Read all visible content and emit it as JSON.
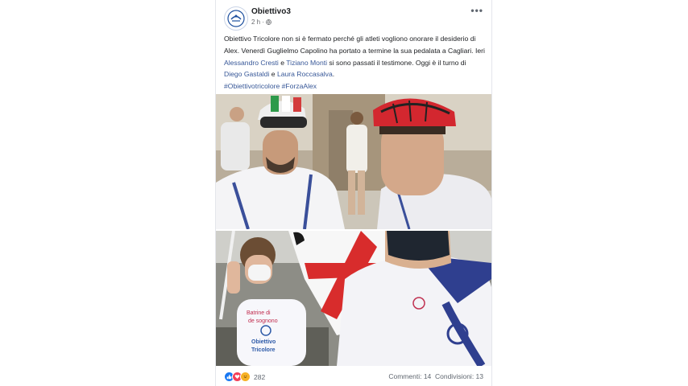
{
  "post": {
    "page_name": "Obiettivo3",
    "time": "2 h ·",
    "more": "•••",
    "text_segments": [
      "Obiettivo Tricolore non si è fermato perché gli atleti vogliono onorare il desiderio di Alex. Venerdì Guglielmo Capolino ha portato a termine la sua pedalata a Cagliari. Ieri ",
      "Alessandro Cresti",
      " e ",
      "Tiziano Monti",
      " si sono passati il testimone. Oggi è il turno di ",
      "Diego Gastaldi",
      " e ",
      "Laura Roccasalva",
      "."
    ],
    "hashtags": "#Obiettivotricolore #ForzaAlex"
  },
  "footer": {
    "reaction_count": "282",
    "stats": "Commenti: 14  Condivisioni: 13"
  },
  "shirt_text": {
    "line1": "Batrine di",
    "line2": "de sognono",
    "line3": "Obiettivo",
    "line4": "Tricolore"
  },
  "colors": {
    "link": "#385898",
    "like": "#1877f2",
    "love": "#f33e58",
    "haha": "#f7b125"
  },
  "icons": [
    "globe-icon",
    "like-reaction-icon",
    "love-reaction-icon",
    "haha-reaction-icon",
    "more-icon"
  ]
}
